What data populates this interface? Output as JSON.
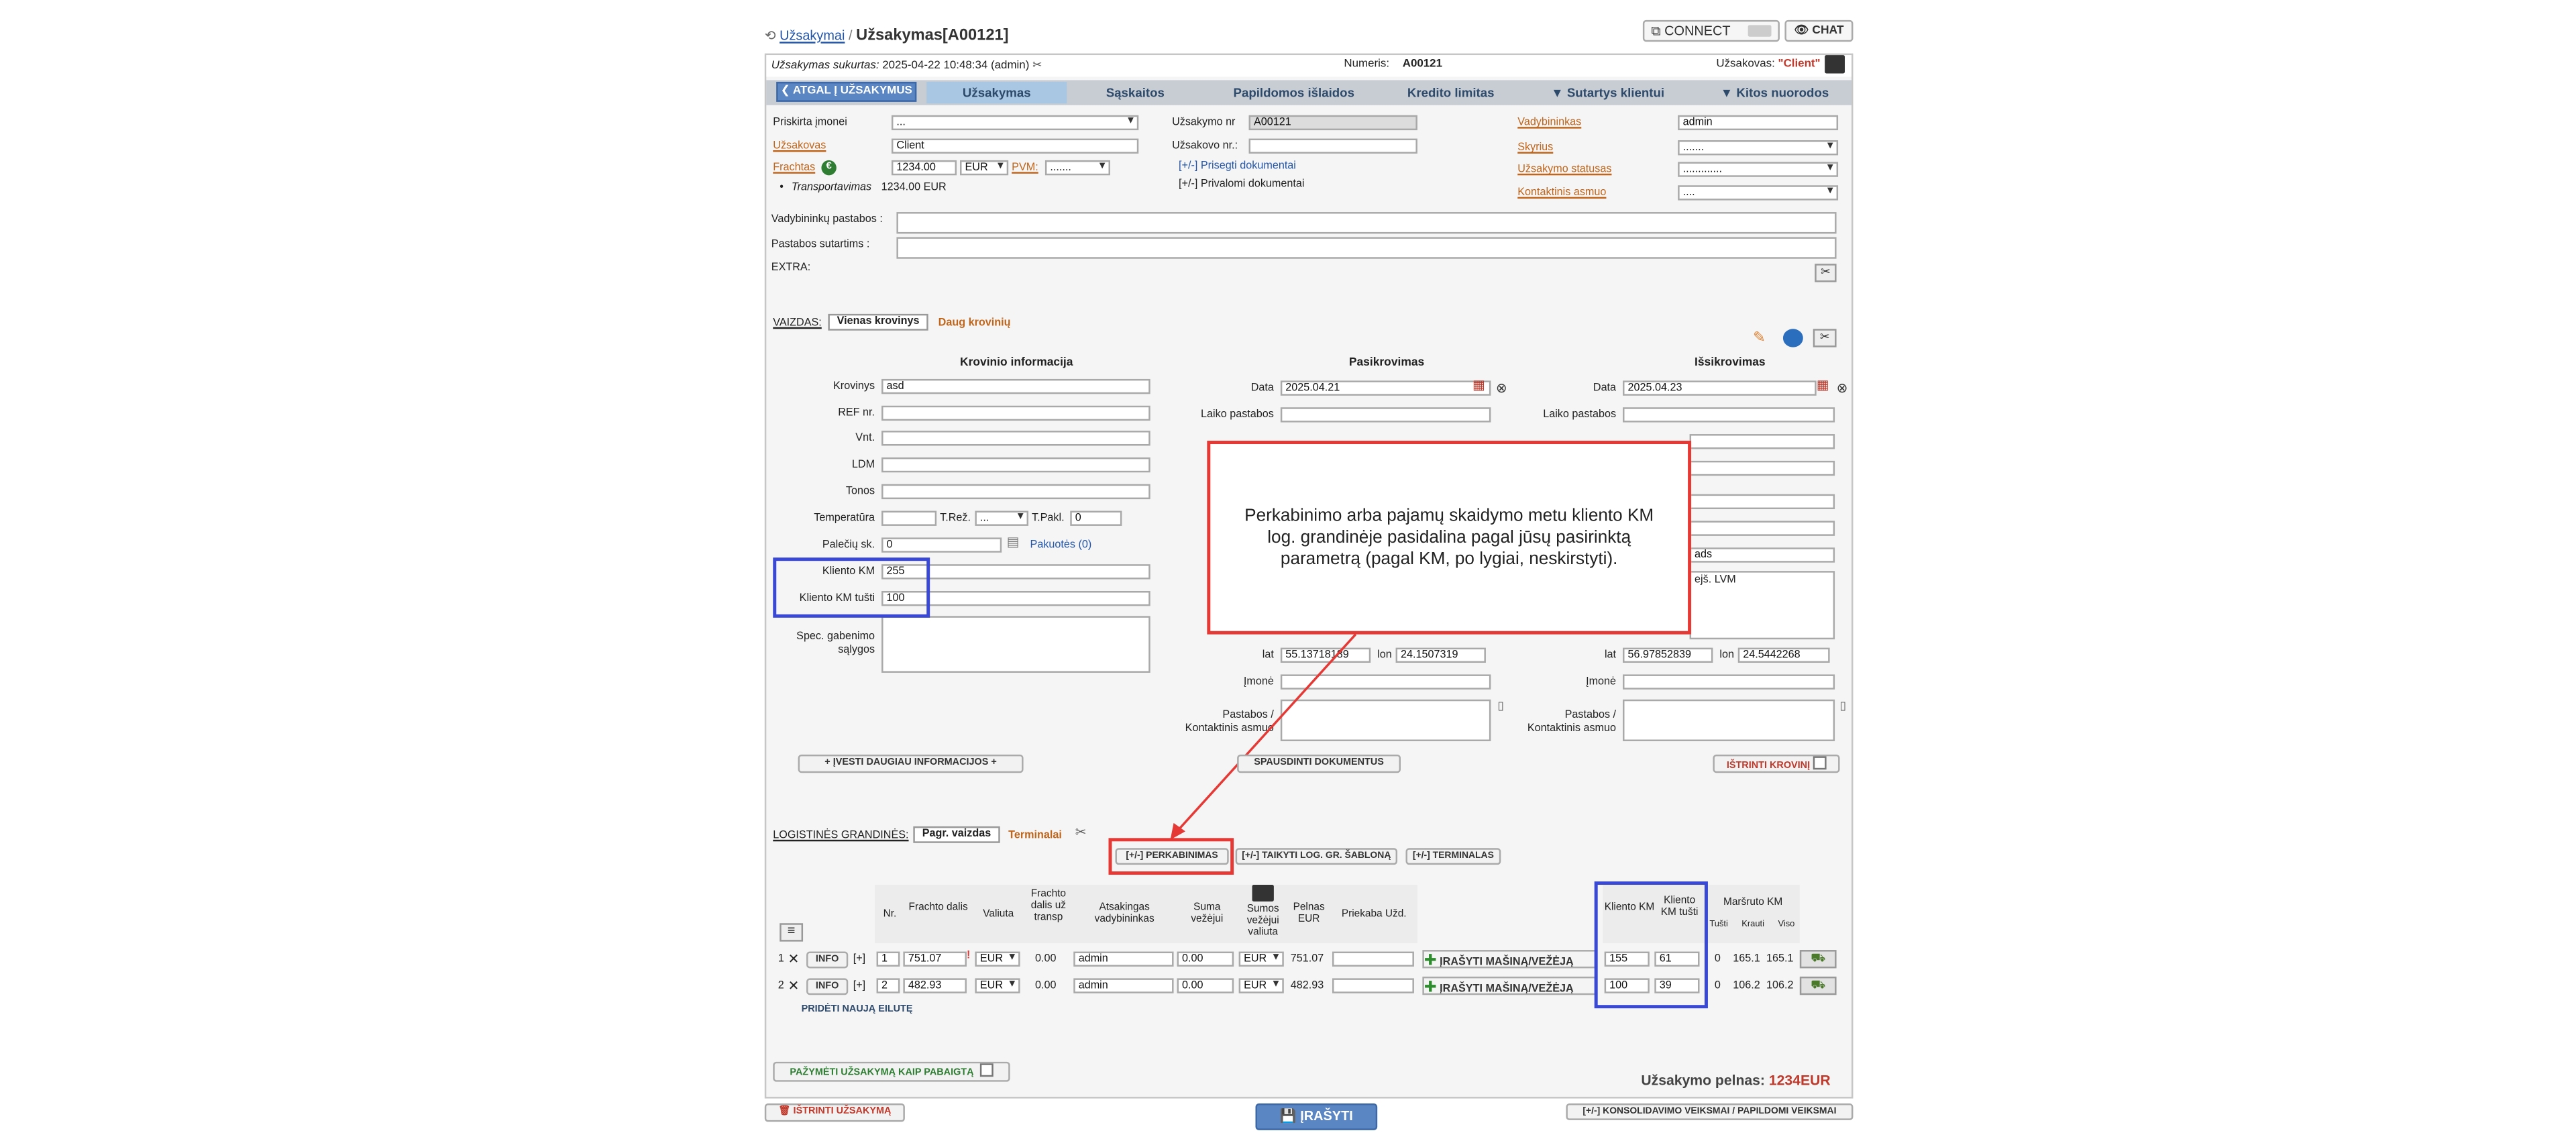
{
  "header": {
    "breadcrumb_link": "Užsakymai",
    "separator": "/",
    "title": "Užsakymas[A00121]",
    "connect_label": "CONNECT",
    "chat_label": "CHAT"
  },
  "info_bar": {
    "created_label": "Užsakymas sukurtas:",
    "created_value": "2025-04-22 10:48:34 (admin)",
    "number_label": "Numeris:",
    "number_value": "A00121",
    "orderer_label": "Užsakovas:",
    "orderer_value": "\"Client\""
  },
  "tabs": {
    "back": "❮ ATGAL Į UŽSAKYMUS",
    "order": "Užsakymas",
    "invoices": "Sąskaitos",
    "extra_costs": "Papildomos išlaidos",
    "credit": "Kredito limitas",
    "contracts": "▼ Sutartys klientui",
    "other": "▼ Kitos nuorodos"
  },
  "form": {
    "assigned_company_label": "Priskirta įmonei",
    "assigned_company_value": "...",
    "client_label": "Užsakovas",
    "client_value": "Client",
    "freight_label": "Frachtas",
    "freight_value": "1234.00",
    "currency_value": "EUR",
    "vat_label": "PVM:",
    "vat_value": ".......",
    "transport_label": "Transportavimas",
    "transport_value": "1234.00 EUR",
    "order_no_label": "Užsakymo nr",
    "order_no_value": "A00121",
    "client_order_label": "Užsakovo nr.:",
    "client_order_value": "",
    "attach_docs": "[+/-] Prisegti dokumentai",
    "private_docs": "[+/-] Privalomi dokumentai",
    "manager_label": "Vadybininkas",
    "manager_value": "admin",
    "department_label": "Skyrius",
    "department_value": ".......",
    "status_label": "Užsakymo statusas",
    "status_value": ".............",
    "contact_label": "Kontaktinis asmuo",
    "contact_value": "....",
    "manager_notes_label": "Vadybininkų pastabos :",
    "contract_notes_label": "Pastabos sutartims :",
    "extra_label": "EXTRA:"
  },
  "view": {
    "label": "VAIZDAS:",
    "single": "Vienas krovinys",
    "multi": "Daug krovinių"
  },
  "cargo": {
    "heading": "Krovinio informacija",
    "cargo_label": "Krovinys",
    "cargo_value": "asd",
    "ref_label": "REF nr.",
    "units_label": "Vnt.",
    "ldm_label": "LDM",
    "tons_label": "Tonos",
    "temp_label": "Temperatūra",
    "treg_label": "T.Rež.",
    "treg_value": "...",
    "tpakl_label": "T.Pakl.",
    "tpakl_value": "0",
    "pallets_label": "Palečių sk.",
    "pallets_value": "0",
    "packages_link": "Pakuotės (0)",
    "client_km_label": "Kliento KM",
    "client_km_value": "255",
    "client_km_empty_label": "Kliento KM tušti",
    "client_km_empty_value": "100",
    "special_label": "Spec. gabenimo sąlygos"
  },
  "loading": {
    "heading": "Pasikrovimas",
    "date_label": "Data",
    "date_value": "2025.04.21",
    "time_note_label": "Laiko pastabos",
    "lat_label": "lat",
    "lat_value": "55.13718189",
    "lon_label": "lon",
    "lon_value": "24.1507319",
    "company_label": "Įmonė",
    "notes_label": "Pastabos / Kontaktinis asmuo"
  },
  "unloading": {
    "heading": "Išsikrovimas",
    "date_label": "Data",
    "date_value": "2025.04.23",
    "time_note_label": "Laiko pastabos",
    "address_partial": "ads",
    "address_partial2": "ejš. LVM",
    "lat_label": "lat",
    "lat_value": "56.97852839",
    "lon_label": "lon",
    "lon_value": "24.5442268",
    "company_label": "Įmonė",
    "notes_label": "Pastabos / Kontaktinis asmuo"
  },
  "actions": {
    "more_info": "+ ĮVESTI DAUGIAU INFORMACIJOS +",
    "print_docs": "SPAUSDINTI DOKUMENTUS",
    "delete_cargo": "IŠTRINTI KROVINĮ"
  },
  "callout": {
    "text": "Perkabinimo arba pajamų skaidymo metu kliento KM log. grandinėje pasidalina pagal jūsų pasirinktą parametrą (pagal KM, po lygiai, neskirstyti)."
  },
  "logistics": {
    "label": "LOGISTINĖS GRANDINĖS:",
    "view_button": "Pagr. vaizdas",
    "terminals_link": "Terminalai",
    "btn_rehook": "[+/-] PERKABINIMAS",
    "btn_template": "[+/-] TAIKYTI LOG. GR. ŠABLONĄ",
    "btn_terminal": "[+/-] TERMINALAS"
  },
  "table": {
    "headers": {
      "nr": "Nr.",
      "freight_part": "Frachto dalis",
      "currency": "Valiuta",
      "freight_part_transp": "Frachto dalis už transp",
      "manager": "Atsakingas vadybininkas",
      "carrier_sum": "Suma vežėjui",
      "carrier_currency": "Sumos vežėjui valiuta",
      "profit": "Pelnas EUR",
      "trailer": "Priekaba Užd.",
      "client_km": "Kliento KM",
      "client_km_empty": "Kliento KM tušti",
      "route_km": "Maršruto KM",
      "empty": "Tušti",
      "loaded": "Krauti",
      "total": "Viso"
    },
    "rows": [
      {
        "idx": "1",
        "info": "INFO",
        "plus": "[+]",
        "nr": "1",
        "freight": "751.07",
        "currency": "EUR",
        "transp": "0.00",
        "manager": "admin",
        "carrier_sum": "0.00",
        "carrier_currency": "EUR",
        "profit": "751.07",
        "assign": "ĮRAŠYTI MAŠINĄ/VEŽĖJĄ",
        "km": "155",
        "km_empty": "61",
        "empty": "0",
        "loaded": "165.1",
        "total": "165.1"
      },
      {
        "idx": "2",
        "info": "INFO",
        "plus": "[+]",
        "nr": "2",
        "freight": "482.93",
        "currency": "EUR",
        "transp": "0.00",
        "manager": "admin",
        "carrier_sum": "0.00",
        "carrier_currency": "EUR",
        "profit": "482.93",
        "assign": "ĮRAŠYTI MAŠINĄ/VEŽĖJĄ",
        "km": "100",
        "km_empty": "39",
        "empty": "0",
        "loaded": "106.2",
        "total": "106.2"
      }
    ],
    "add_row": "PRIDĖTI NAUJĄ EILUTĘ"
  },
  "footer": {
    "mark_done": "PAŽYMĖTI UŽSAKYMĄ KAIP PABAIGTĄ",
    "profit_label": "Užsakymo pelnas:",
    "profit_value": "1234EUR",
    "delete_order": "IŠTRINTI UŽSAKYMĄ",
    "save": "ĮRAŠYTI",
    "consolidate": "[+/-] KONSOLIDAVIMO VEIKSMAI / PAPILDOMI VEIKSMAI"
  },
  "colors": {
    "tab_active": "#a9c6e2",
    "tab_back": "#5b86c4",
    "callout_border": "#e53935",
    "highlight_box": "#3949d6",
    "profit_red": "#c0392b"
  }
}
